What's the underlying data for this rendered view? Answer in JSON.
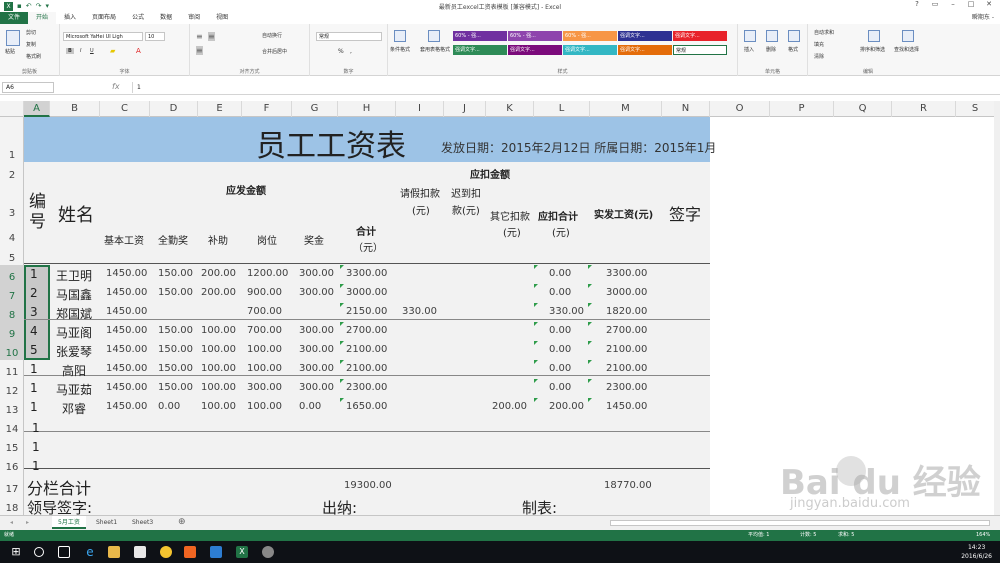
{
  "app": {
    "title": "最新员工excel工资表模板 [兼容模式] - Excel",
    "user": "瞬期东 -",
    "ribbon_tabs": [
      "文件",
      "开始",
      "插入",
      "页面布局",
      "公式",
      "数据",
      "审阅",
      "视图"
    ]
  },
  "ribbon": {
    "clipboard": {
      "paste": "粘贴",
      "cut": "剪切",
      "copy": "复制",
      "format_painter": "格式刷",
      "label": "剪贴板"
    },
    "font": {
      "name": "Microsoft YaHei UI Ligh",
      "size": "10",
      "label": "字体",
      "bold": "B",
      "italic": "I",
      "underline": "U"
    },
    "align": {
      "wrap": "自动换行",
      "merge": "合并后居中",
      "label": "对齐方式"
    },
    "number": {
      "format": "常规",
      "label": "数字",
      "percent": "%",
      "comma": ","
    },
    "styles": {
      "cond_format": "条件格式",
      "table_format": "套用表格格式",
      "label": "样式",
      "cells": [
        {
          "text": "60% - 强...",
          "color": "#7030a0"
        },
        {
          "text": "60% - 强...",
          "color": "#8e44ad"
        },
        {
          "text": "60% - 强...",
          "color": "#f79646"
        },
        {
          "text": "强调文字...",
          "color": "#2e3192"
        },
        {
          "text": "强调文字...",
          "color": "#e8232b"
        },
        {
          "text": "强调文字...",
          "color": "#2e8b57"
        },
        {
          "text": "强调文字...",
          "color": "#7b0a7b"
        },
        {
          "text": "强调文字...",
          "color": "#33b7c4"
        },
        {
          "text": "强调文字...",
          "color": "#e46c0a"
        },
        {
          "text": "常规",
          "color": "#ffffff"
        }
      ]
    },
    "cells_grp": {
      "insert": "插入",
      "delete": "删除",
      "format": "格式",
      "label": "单元格"
    },
    "editing": {
      "autosum": "自动求和",
      "fill": "填充",
      "clear": "清除",
      "sort": "排序和筛选",
      "find": "查找和选择",
      "label": "编辑"
    }
  },
  "formula_bar": {
    "name_box": "A6",
    "fx": "fx",
    "value": "1"
  },
  "columns": [
    "A",
    "B",
    "C",
    "D",
    "E",
    "F",
    "G",
    "H",
    "I",
    "J",
    "K",
    "L",
    "M",
    "N",
    "O",
    "P",
    "Q",
    "R",
    "S"
  ],
  "rows": [
    "1",
    "2",
    "3",
    "4",
    "5",
    "6",
    "7",
    "8",
    "9",
    "10",
    "11",
    "12",
    "13",
    "14",
    "15",
    "16",
    "17",
    "18"
  ],
  "sheet": {
    "title": "员工工资表",
    "issue_date": "发放日期：2015年2月12日 所属日期：2015年1月",
    "hdr_yingfa": "应发金额",
    "hdr_yingkou": "应扣金额",
    "hdr_bianhao": "编号",
    "hdr_xingming": "姓名",
    "hdr_jiben": "基本工资",
    "hdr_quanqin": "全勤奖",
    "hdr_buzhu": "补助",
    "hdr_gangwei": "岗位",
    "hdr_jiangjin": "奖金",
    "hdr_heji": "合计",
    "hdr_heji_unit": "（元）",
    "hdr_qingjia": "请假扣款",
    "hdr_qingjia_unit": "(元)",
    "hdr_chidao": "迟到扣",
    "hdr_chidao2": "款(元)",
    "hdr_qita": "其它扣款",
    "hdr_qita_unit": "(元)",
    "hdr_koukuan_heji": "应扣合计",
    "hdr_koukuan_unit": "(元)",
    "hdr_shifa": "实发工资(元)",
    "hdr_qianzi": "签字",
    "records": [
      {
        "no": "1",
        "name": "王卫明",
        "base": "1450.00",
        "attend": "150.00",
        "allow": "200.00",
        "post": "1200.00",
        "bonus": "300.00",
        "total": "3300.00",
        "leave": "",
        "late": "",
        "other": "",
        "deduct": "0.00",
        "net": "3300.00"
      },
      {
        "no": "2",
        "name": "马国鑫",
        "base": "1450.00",
        "attend": "150.00",
        "allow": "200.00",
        "post": "900.00",
        "bonus": "300.00",
        "total": "3000.00",
        "leave": "",
        "late": "",
        "other": "",
        "deduct": "0.00",
        "net": "3000.00"
      },
      {
        "no": "3",
        "name": "郑国斌",
        "base": "1450.00",
        "attend": "",
        "allow": "",
        "post": "700.00",
        "bonus": "",
        "total": "2150.00",
        "leave": "330.00",
        "late": "",
        "other": "",
        "deduct": "330.00",
        "net": "1820.00"
      },
      {
        "no": "4",
        "name": "马亚阁",
        "base": "1450.00",
        "attend": "150.00",
        "allow": "100.00",
        "post": "700.00",
        "bonus": "300.00",
        "total": "2700.00",
        "leave": "",
        "late": "",
        "other": "",
        "deduct": "0.00",
        "net": "2700.00"
      },
      {
        "no": "5",
        "name": "张爱琴",
        "base": "1450.00",
        "attend": "150.00",
        "allow": "100.00",
        "post": "100.00",
        "bonus": "300.00",
        "total": "2100.00",
        "leave": "",
        "late": "",
        "other": "",
        "deduct": "0.00",
        "net": "2100.00"
      },
      {
        "no": "1",
        "name": "高阳",
        "base": "1450.00",
        "attend": "150.00",
        "allow": "100.00",
        "post": "100.00",
        "bonus": "300.00",
        "total": "2100.00",
        "leave": "",
        "late": "",
        "other": "",
        "deduct": "0.00",
        "net": "2100.00"
      },
      {
        "no": "1",
        "name": "马亚茹",
        "base": "1450.00",
        "attend": "150.00",
        "allow": "100.00",
        "post": "300.00",
        "bonus": "300.00",
        "total": "2300.00",
        "leave": "",
        "late": "",
        "other": "",
        "deduct": "0.00",
        "net": "2300.00"
      },
      {
        "no": "1",
        "name": "邓睿",
        "base": "1450.00",
        "attend": "0.00",
        "allow": "100.00",
        "post": "100.00",
        "bonus": "0.00",
        "total": "1650.00",
        "leave": "",
        "late": "",
        "other": "200.00",
        "deduct": "200.00",
        "net": "1450.00"
      }
    ],
    "extra_no": [
      "1",
      "1",
      "1"
    ],
    "subtotal_label": "分栏合计",
    "subtotal_total": "19300.00",
    "subtotal_net": "18770.00",
    "sign_leader": "领导签字:",
    "sign_cashier": "出纳:",
    "sign_maker": "制表:"
  },
  "sheet_tabs": [
    "5月工资",
    "Sheet1",
    "Sheet3"
  ],
  "status": {
    "ready": "就绪",
    "average": "平均值: 1",
    "count": "计数: 5",
    "sum": "求和: 5",
    "zoom": "164%"
  },
  "taskbar": {
    "time": "14:23",
    "date": "2016/6/26"
  },
  "watermark": {
    "main": "Bai du 经验",
    "sub": "jingyan.baidu.com"
  }
}
